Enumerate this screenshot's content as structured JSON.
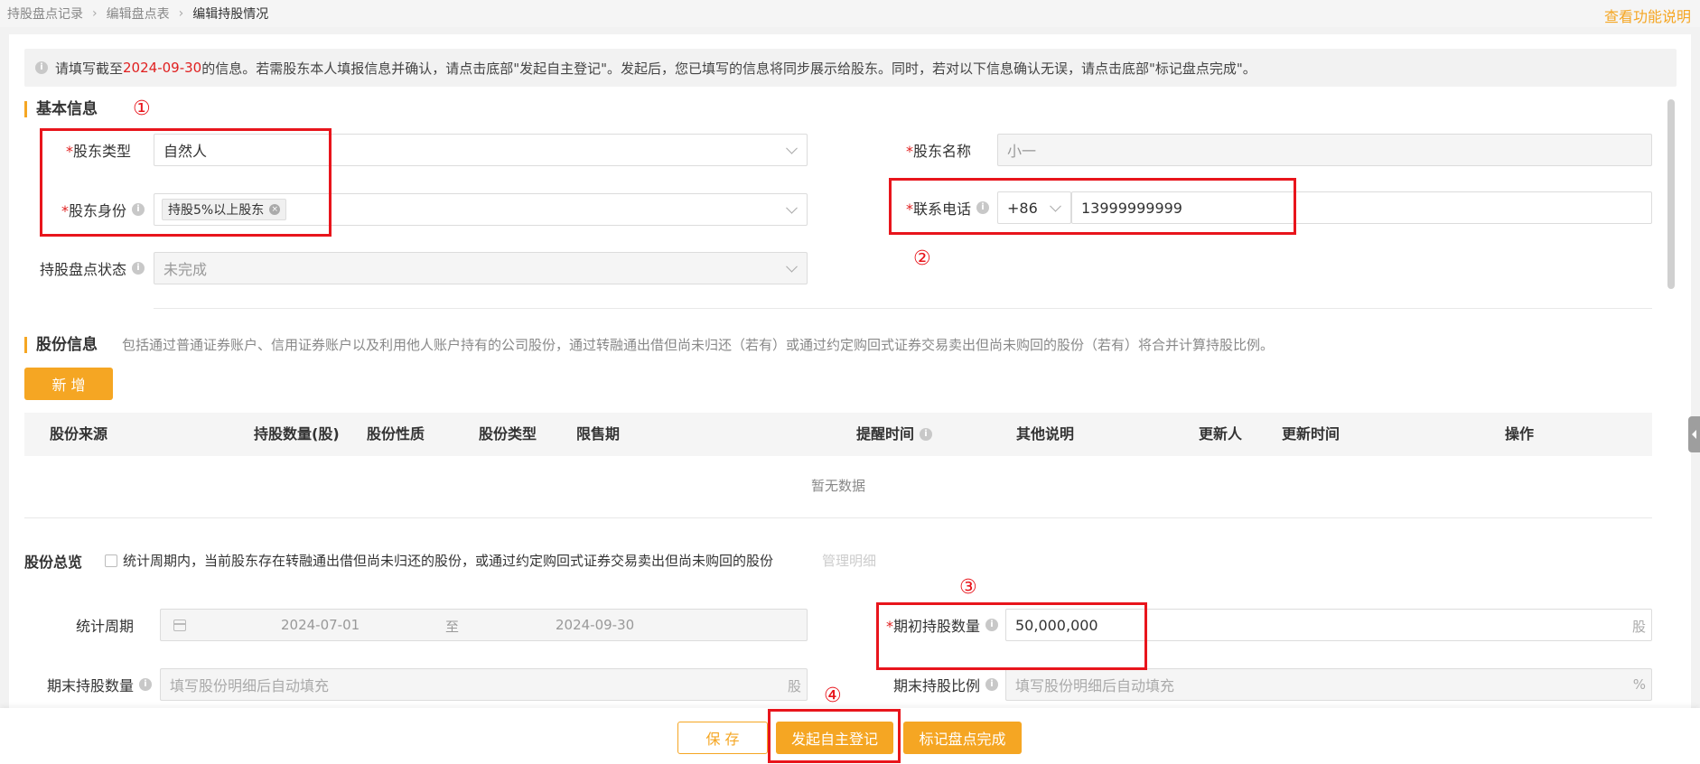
{
  "breadcrumb": {
    "items": [
      "持股盘点记录",
      "编辑盘点表",
      "编辑持股情况"
    ]
  },
  "help_link": "查看功能说明",
  "notice": {
    "prefix": "请填写截至",
    "date": "2024-09-30",
    "suffix": "的信息。若需股东本人填报信息并确认，请点击底部\"发起自主登记\"。发起后，您已填写的信息将同步展示给股东。同时，若对以下信息确认无误，请点击底部\"标记盘点完成\"。"
  },
  "basic_info": {
    "title": "基本信息",
    "shareholder_type": {
      "label": "股东类型",
      "value": "自然人"
    },
    "shareholder_identity": {
      "label": "股东身份",
      "tag": "持股5%以上股东"
    },
    "inventory_status": {
      "label": "持股盘点状态",
      "value": "未完成"
    },
    "shareholder_name": {
      "label": "股东名称",
      "value": "小一"
    },
    "phone": {
      "label": "联系电话",
      "country_code": "+86",
      "number": "13999999999"
    }
  },
  "share_info": {
    "title": "股份信息",
    "description": "包括通过普通证券账户、信用证券账户以及利用他人账户持有的公司股份，通过转融通出借但尚未归还（若有）或通过约定购回式证券交易卖出但尚未购回的股份（若有）将合并计算持股比例。",
    "add_button": "新 增",
    "columns": [
      "股份来源",
      "持股数量(股)",
      "股份性质",
      "股份类型",
      "限售期",
      "提醒时间",
      "其他说明",
      "更新人",
      "更新时间",
      "操作"
    ],
    "empty_text": "暂无数据"
  },
  "overview": {
    "title": "股份总览",
    "checkbox_label": "统计周期内，当前股东存在转融通出借但尚未归还的股份，或通过约定购回式证券交易卖出但尚未购回的股份",
    "manage_link": "管理明细",
    "period": {
      "label": "统计周期",
      "start": "2024-07-01",
      "sep": "至",
      "end": "2024-09-30"
    },
    "initial_shares": {
      "label": "期初持股数量",
      "value": "50,000,000",
      "unit": "股"
    },
    "final_shares": {
      "label": "期末持股数量",
      "placeholder": "填写股份明细后自动填充",
      "unit": "股"
    },
    "final_ratio": {
      "label": "期末持股比例",
      "placeholder": "填写股份明细后自动填充",
      "unit": "%"
    }
  },
  "annotations": [
    "①",
    "②",
    "③",
    "④"
  ],
  "footer": {
    "save": "保 存",
    "self_register": "发起自主登记",
    "mark_complete": "标记盘点完成"
  },
  "colors": {
    "accent": "#f5a623",
    "highlight_red": "#e8151c"
  }
}
